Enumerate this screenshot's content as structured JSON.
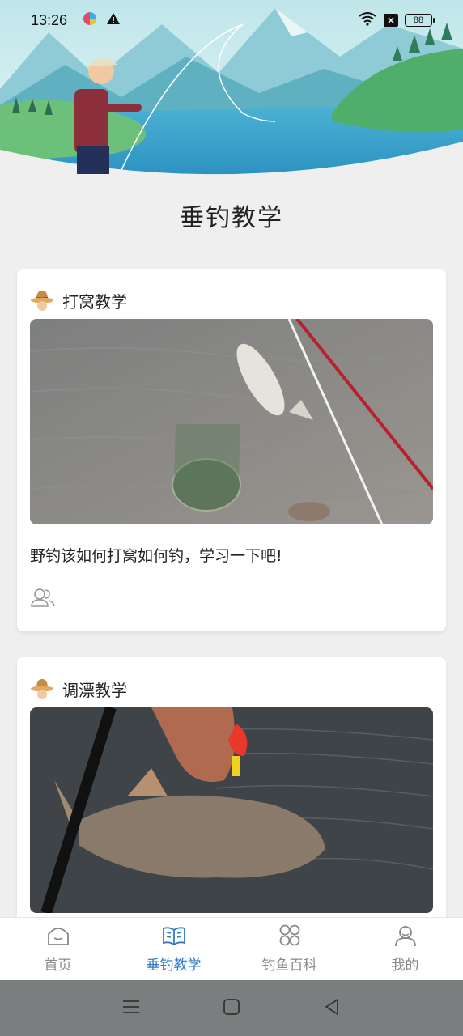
{
  "status_bar": {
    "time": "13:26",
    "battery": "88"
  },
  "page": {
    "title": "垂钓教学"
  },
  "cards": [
    {
      "title": "打窝教学",
      "description": "野钓该如何打窝如何钓，学习一下吧!"
    },
    {
      "title": "调漂教学"
    }
  ],
  "tabbar": {
    "items": [
      {
        "label": "首页",
        "icon": "home-icon"
      },
      {
        "label": "垂钓教学",
        "icon": "book-icon"
      },
      {
        "label": "钓鱼百科",
        "icon": "grid-icon"
      },
      {
        "label": "我的",
        "icon": "user-icon"
      }
    ],
    "active_color": "#2f78c8",
    "inactive_color": "#888888"
  }
}
